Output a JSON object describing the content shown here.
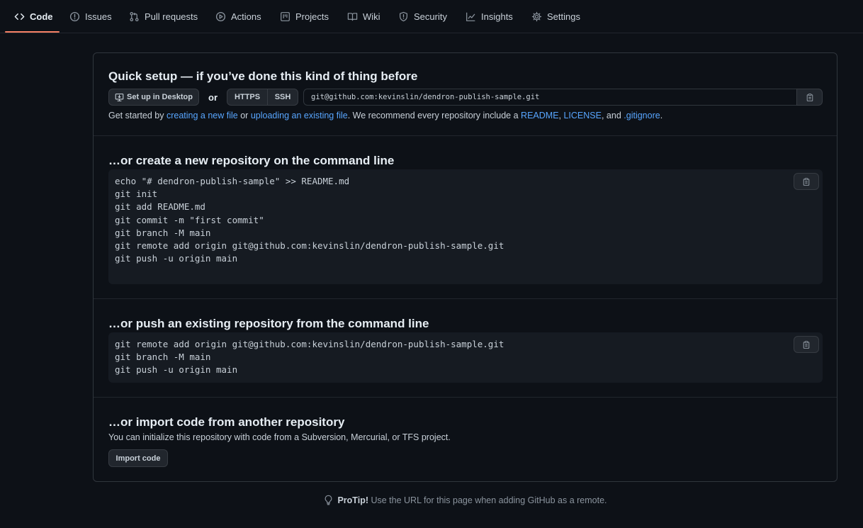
{
  "nav": {
    "tabs": [
      {
        "label": "Code",
        "icon": "code-icon",
        "active": true
      },
      {
        "label": "Issues",
        "icon": "issue-icon"
      },
      {
        "label": "Pull requests",
        "icon": "pull-request-icon"
      },
      {
        "label": "Actions",
        "icon": "play-icon"
      },
      {
        "label": "Projects",
        "icon": "project-icon"
      },
      {
        "label": "Wiki",
        "icon": "book-icon"
      },
      {
        "label": "Security",
        "icon": "shield-icon"
      },
      {
        "label": "Insights",
        "icon": "graph-icon"
      },
      {
        "label": "Settings",
        "icon": "gear-icon"
      }
    ],
    "accent": "#f78166"
  },
  "quick_setup": {
    "title": "Quick setup — if you’ve done this kind of thing before",
    "desktop_button": "Set up in Desktop",
    "or": "or",
    "protocols": [
      "HTTPS",
      "SSH"
    ],
    "selected_protocol": "SSH",
    "url": "git@github.com:kevinslin/dendron-publish-sample.git",
    "hint": {
      "prefix": "Get started by ",
      "link_new_file": "creating a new file",
      "mid1": " or ",
      "link_upload": "uploading an existing file",
      "mid2": ". We recommend every repository include a ",
      "link_readme": "README",
      "comma1": ", ",
      "link_license": "LICENSE",
      "and": ", and ",
      "link_gitignore": ".gitignore",
      "end": "."
    }
  },
  "new_repo": {
    "title": "…or create a new repository on the command line",
    "code": "echo \"# dendron-publish-sample\" >> README.md\ngit init\ngit add README.md\ngit commit -m \"first commit\"\ngit branch -M main\ngit remote add origin git@github.com:kevinslin/dendron-publish-sample.git\ngit push -u origin main"
  },
  "push_repo": {
    "title": "…or push an existing repository from the command line",
    "code": "git remote add origin git@github.com:kevinslin/dendron-publish-sample.git\ngit branch -M main\ngit push -u origin main"
  },
  "import_repo": {
    "title": "…or import code from another repository",
    "description": "You can initialize this repository with code from a Subversion, Mercurial, or TFS project.",
    "button": "Import code"
  },
  "protip": {
    "label": "ProTip!",
    "text": " Use the URL for this page when adding GitHub as a remote."
  }
}
